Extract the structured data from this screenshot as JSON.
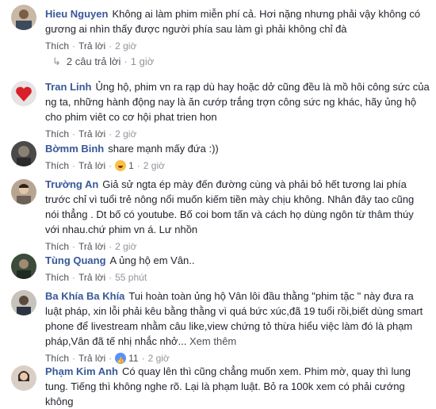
{
  "comments": [
    {
      "name": "Hieu Nguyen",
      "text": "Không ai làm phim miễn phí cả. Hơi nặng nhưng phải vậy không có gương ai nhìn thấy được người phía sau làm gì phải không chỉ đà",
      "like": "Thích",
      "reply": "Trả lời",
      "time": "2 giờ"
    },
    {
      "name": "Tran Linh",
      "text": "Ủng hộ, phim vn ra rạp dù hay hoặc dở cũng đều là mồ hôi công sức của ng ta, những hành động nay là ăn cướp trắng trợn công sức ng khác, hãy ủng hộ cho phim viêt co cơ hội phat trien hon",
      "like": "Thích",
      "reply": "Trả lời",
      "time": "2 giờ"
    },
    {
      "name": "Bờmm Binh",
      "text": "share mạnh mấy đứa :))",
      "like": "Thích",
      "reply": "Trả lời",
      "reaction_count": "1",
      "time": "2 giờ"
    },
    {
      "name": "Trường An",
      "text": "Giả sử ngta ép mày đến đường cùng và phải bỏ hết tương lai phía trước chỉ vì tuổi trẻ nông nổi muốn kiếm tiền mày chịu không. Nhân đây tao cũng nói thẳng . Dt bố có youtube. Bố coi bom tấn và cách họ dùng ngôn từ thâm thúy với nhau.chứ phim vn á. Lư nhồn",
      "like": "Thích",
      "reply": "Trả lời",
      "time": "2 giờ"
    },
    {
      "name": "Tùng Quang",
      "text": "A ủng hộ em Vân..",
      "like": "Thích",
      "reply": "Trả lời",
      "time": "55 phút"
    },
    {
      "name": "Ba Khía Ba Khía",
      "text": "Tui hoàn toàn ủng hộ Vân lôi đầu thằng \"phim tặc \" này đưa ra luật pháp, xin lỗi phải kêu bằng thằng vì quá bức xúc,đã 19 tuổi rồi,biết dùng smart phone để livestream nhằm câu like,view chứng tỏ thừa hiểu việc làm đó là phạm pháp,Vân đã tế nhị nhắc nhở...",
      "see_more": "Xem thêm",
      "like": "Thích",
      "reply": "Trả lời",
      "reaction_count": "11",
      "time": "2 giờ"
    },
    {
      "name": "Phạm Kim Anh",
      "text": "Có quay lên thì cũng chẳng muốn xem. Phim mờ, quay thì lung tung. Tiếng thì không nghe rõ. Lại là phạm luật. Bỏ ra 100k xem có phải cướng không",
      "like": "",
      "reply": "",
      "time": ""
    }
  ],
  "replies_summary": {
    "label": "2 câu trả lời",
    "time": "1 giờ"
  },
  "separator": "·",
  "colors": {
    "name": "#385898",
    "meta": "#90949c",
    "action": "#4b4f56"
  }
}
